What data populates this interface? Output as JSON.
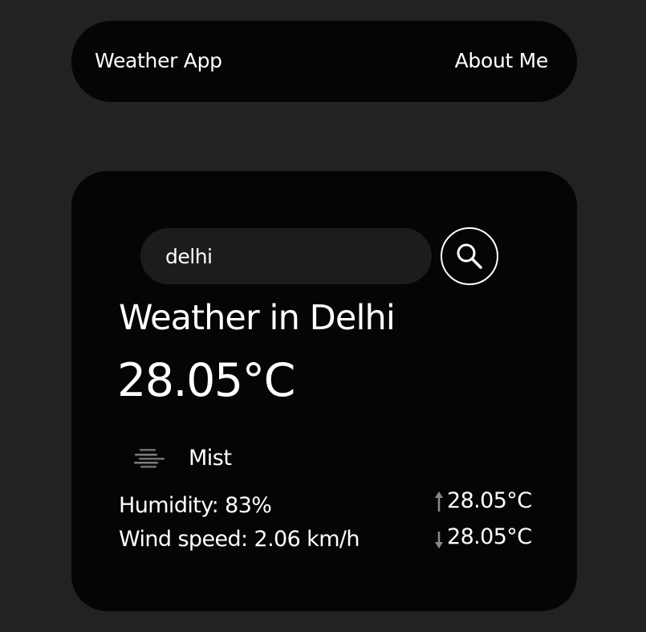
{
  "navbar": {
    "title": "Weather App",
    "about_link": "About Me"
  },
  "search": {
    "value": "delhi",
    "icon": "search-icon"
  },
  "weather": {
    "heading": "Weather in Delhi",
    "temperature": "28.05°C",
    "condition": "Mist",
    "condition_icon": "mist-icon",
    "humidity": "Humidity: 83%",
    "wind_speed": "Wind speed: 2.06 km/h",
    "temp_max": "28.05°C",
    "temp_min": "28.05°C",
    "temp_max_icon": "arrow-up-icon",
    "temp_min_icon": "arrow-down-icon"
  },
  "colors": {
    "page_background": "#222222",
    "panel_background": "#050505",
    "input_background": "#1c1c1c",
    "text": "#ffffff",
    "muted_icon": "#8a8a8a"
  }
}
